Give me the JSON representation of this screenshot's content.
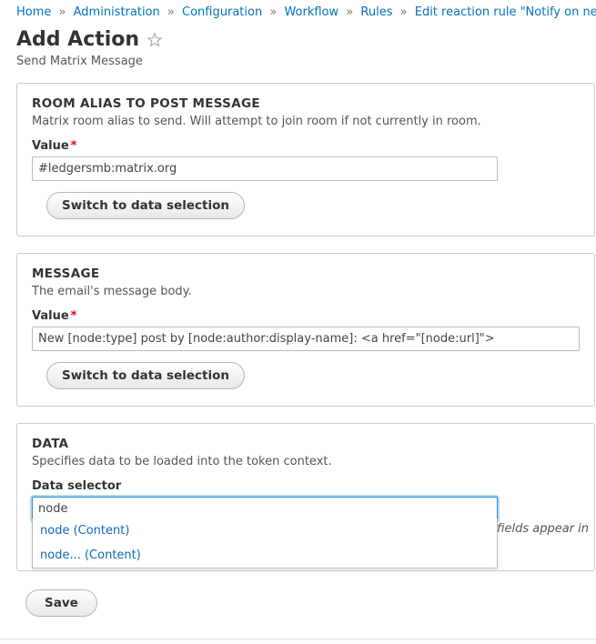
{
  "breadcrumb": {
    "items": [
      {
        "label": "Home"
      },
      {
        "label": "Administration"
      },
      {
        "label": "Configuration"
      },
      {
        "label": "Workflow"
      },
      {
        "label": "Rules"
      },
      {
        "label": "Edit reaction rule \"Notify on new con"
      }
    ],
    "separator": "»"
  },
  "page": {
    "title": "Add Action",
    "subtitle": "Send Matrix Message"
  },
  "panels": {
    "room_alias": {
      "title": "ROOM ALIAS TO POST MESSAGE",
      "description": "Matrix room alias to send. Will attempt to join room if not currently in room.",
      "value_label": "Value",
      "required_mark": "*",
      "value": "#ledgersmb:matrix.org",
      "switch_label": "Switch to data selection"
    },
    "message": {
      "title": "MESSAGE",
      "description": "The email's message body.",
      "value_label": "Value",
      "required_mark": "*",
      "value": "New [node:type] post by [node:author:display-name]: <a href=\"[node:url]\">",
      "switch_label": "Switch to data selection"
    },
    "data": {
      "title": "DATA",
      "description": "Specifies data to be loaded into the token context.",
      "selector_label": "Data selector",
      "value": "node",
      "autocomplete": [
        "node (Content)",
        "node... (Content)"
      ],
      "hint_fragment": "y fields appear in"
    }
  },
  "actions": {
    "save_label": "Save"
  }
}
